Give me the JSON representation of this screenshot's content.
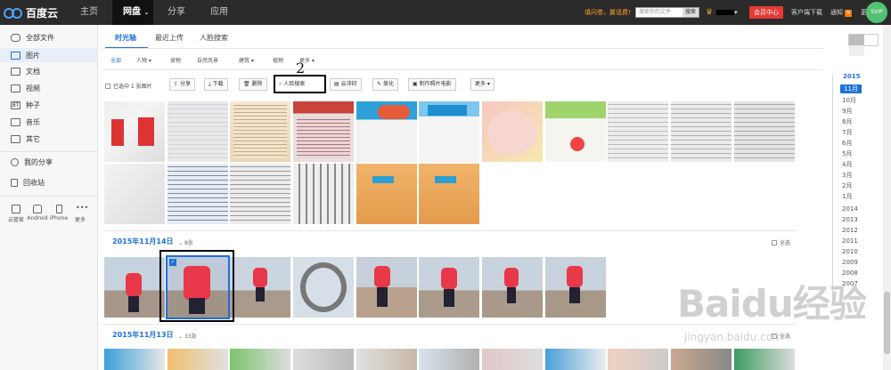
{
  "topbar": {
    "logo_text": "百度云",
    "nav": [
      "主页",
      "网盘",
      "分享",
      "应用"
    ],
    "promo": "填问卷，赢话费!",
    "search_placeholder": "搜索你的文件",
    "search_button": "搜索",
    "vip": "会员中心",
    "client_download": "客户端下载",
    "notify": "通知",
    "notify_count": "9",
    "more": "更多"
  },
  "sidebar": {
    "items": [
      {
        "label": "全部文件",
        "icon": "cloud-icon"
      },
      {
        "label": "图片",
        "icon": "image-icon"
      },
      {
        "label": "文档",
        "icon": "document-icon"
      },
      {
        "label": "视频",
        "icon": "video-icon"
      },
      {
        "label": "种子",
        "icon": "bt-icon"
      },
      {
        "label": "音乐",
        "icon": "music-icon"
      },
      {
        "label": "其它",
        "icon": "other-icon"
      },
      {
        "label": "我的分享",
        "icon": "share-icon"
      },
      {
        "label": "回收站",
        "icon": "trash-icon"
      }
    ],
    "devices": [
      "云管家",
      "Android",
      "iPhone",
      "更多"
    ]
  },
  "tabs": [
    "时光轴",
    "最近上传",
    "人脸搜索"
  ],
  "filters": [
    "全部",
    "人物 ▾",
    "食物",
    "自然风景",
    "建筑 ▾",
    "植物",
    "更多 ▾"
  ],
  "toolbar": {
    "selection_info": "已选中 1 张图片",
    "buttons": [
      "分享",
      "下载",
      "删除",
      "人脸搜索",
      "云冲印",
      "美化",
      "制作照片电影",
      "更多 ▾"
    ]
  },
  "sections": [
    {
      "date": "2015年11月14日",
      "count": "8张",
      "select_all": "全选"
    },
    {
      "date": "2015年11月13日",
      "count": "33张",
      "select_all": "全选"
    }
  ],
  "timeline": {
    "year_current": "2015",
    "month_active": "11月",
    "months": [
      "10月",
      "9月",
      "8月",
      "7月",
      "6月",
      "5月",
      "4月",
      "3月",
      "2月",
      "1月"
    ],
    "years": [
      "2014",
      "2013",
      "2012",
      "2011",
      "2010",
      "2009",
      "2008",
      "2007"
    ]
  },
  "annotation": "2",
  "watermark": {
    "brand": "Baidu经验",
    "url": "jingyan.baidu.com"
  },
  "colors": {
    "accent": "#1e6fd9",
    "topbar": "#2b2b2b",
    "vip": "#e53935"
  }
}
